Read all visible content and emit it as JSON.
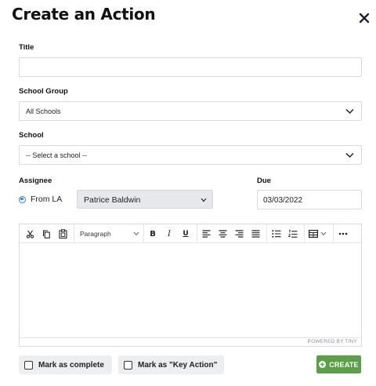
{
  "modal": {
    "title": "Create an Action"
  },
  "form": {
    "title_label": "Title",
    "title_value": "",
    "school_group_label": "School Group",
    "school_group_value": "All Schools",
    "school_label": "School",
    "school_value": "-- Select a school --",
    "assignee_label": "Assignee",
    "assignee_radio_label": "From LA",
    "assignee_value": "Patrice Baldwin",
    "due_label": "Due",
    "due_value": "03/03/2022"
  },
  "editor": {
    "block_format": "Paragraph",
    "bold": "B",
    "italic": "I",
    "underline": "U",
    "powered_by": "POWERED BY TINY"
  },
  "footer": {
    "mark_complete_label": "Mark as complete",
    "mark_key_action_label": "Mark as \"Key Action\"",
    "create_label": "CREATE"
  },
  "colors": {
    "create_button": "#5aa046",
    "radio_accent": "#2f7fe0"
  },
  "icons": [
    "close-icon",
    "chevron-down-icon",
    "cut-icon",
    "copy-icon",
    "paste-icon",
    "align-left-icon",
    "align-center-icon",
    "align-right-icon",
    "align-justify-icon",
    "bullet-list-icon",
    "numbered-list-icon",
    "table-icon",
    "more-icon",
    "plus-circle-icon"
  ]
}
